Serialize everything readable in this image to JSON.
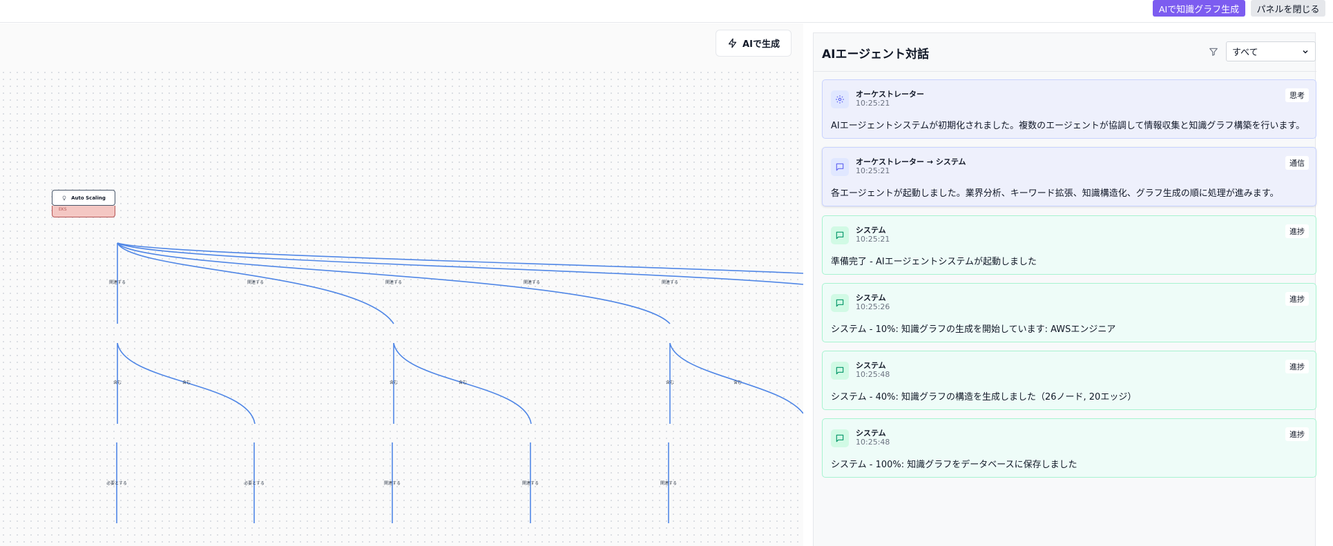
{
  "topbar": {
    "generate_graph_label": "AIで知識グラフ生成",
    "close_panel_label": "パネルを閉じる"
  },
  "canvas": {
    "ai_generate_label": "AIで生成",
    "node": {
      "title": "Auto Scaling",
      "subtitle": "EKS"
    },
    "edge_labels": {
      "row1": [
        "関連する",
        "関連する",
        "関連する",
        "関連する",
        "関連する"
      ],
      "row2": [
        "含む",
        "含む",
        "含む",
        "含む",
        "含む",
        "含む"
      ],
      "row3": [
        "必要とする",
        "必要とする",
        "関連する",
        "関連する",
        "関連する"
      ]
    }
  },
  "panel": {
    "title": "AIエージェント対話",
    "filter": {
      "selected": "すべて"
    },
    "messages": [
      {
        "type": "think",
        "icon": "gear-icon",
        "sender": "オーケストレーター",
        "time": "10:25:21",
        "badge": "思考",
        "text": "AIエージェントシステムが初期化されました。複数のエージェントが協調して情報収集と知識グラフ構築を行います。"
      },
      {
        "type": "comm",
        "icon": "chat-icon",
        "sender": "オーケストレーター → システム",
        "time": "10:25:21",
        "badge": "通信",
        "text": "各エージェントが起動しました。業界分析、キーワード拡張、知識構造化、グラフ生成の順に処理が進みます。"
      },
      {
        "type": "prog",
        "icon": "chat-icon",
        "sender": "システム",
        "time": "10:25:21",
        "badge": "進捗",
        "text": "準備完了 - AIエージェントシステムが起動しました"
      },
      {
        "type": "prog",
        "icon": "chat-icon",
        "sender": "システム",
        "time": "10:25:26",
        "badge": "進捗",
        "text": "システム - 10%: 知識グラフの生成を開始しています: AWSエンジニア"
      },
      {
        "type": "prog",
        "icon": "chat-icon",
        "sender": "システム",
        "time": "10:25:48",
        "badge": "進捗",
        "text": "システム - 40%: 知識グラフの構造を生成しました（26ノード, 20エッジ）"
      },
      {
        "type": "prog",
        "icon": "chat-icon",
        "sender": "システム",
        "time": "10:25:48",
        "badge": "進捗",
        "text": "システム - 100%: 知識グラフをデータベースに保存しました"
      }
    ]
  },
  "colors": {
    "accent": "#7c5cf0",
    "edge": "#4f86e6"
  }
}
